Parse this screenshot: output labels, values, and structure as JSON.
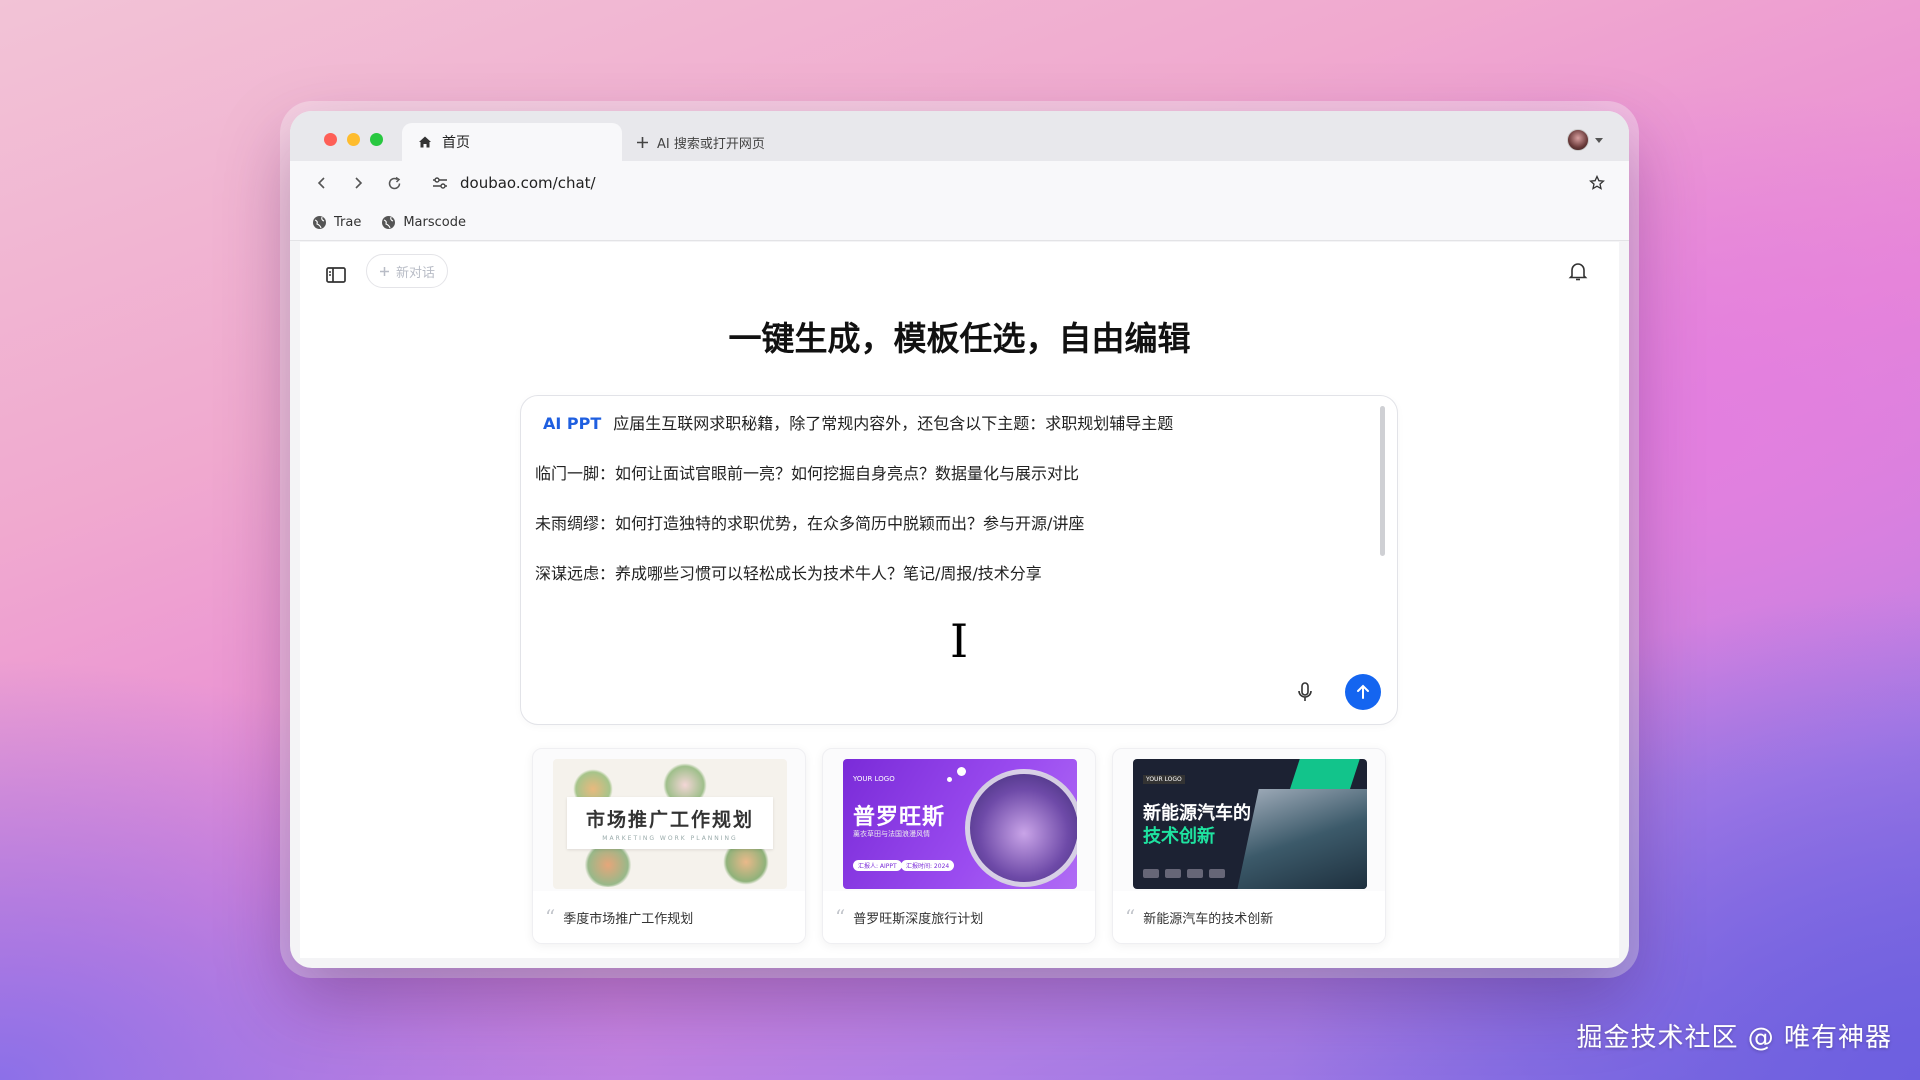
{
  "browser": {
    "active_tab": {
      "label": "首页",
      "icon": "home-icon"
    },
    "new_tab": {
      "label": "AI 搜索或打开网页",
      "icon": "plus-icon"
    },
    "url": "doubao.com/chat/",
    "bookmarks": [
      {
        "label": "Trae",
        "icon": "globe-icon"
      },
      {
        "label": "Marscode",
        "icon": "globe-icon"
      }
    ]
  },
  "page": {
    "new_chat_label": "新对话",
    "headline": "一键生成，模板任选，自由编辑",
    "composer": {
      "tag": "AI PPT",
      "lines": [
        "应届生互联网求职秘籍，除了常规内容外，还包含以下主题：求职规划辅导主题",
        "临门一脚：如何让面试官眼前一亮？如何挖掘自身亮点？数据量化与展示对比",
        "未雨绸缪：如何打造独特的求职优势，在众多简历中脱颖而出？参与开源/讲座",
        "深谋远虑：养成哪些习惯可以轻松成长为技术牛人？笔记/周报/技术分享"
      ]
    },
    "templates": [
      {
        "caption": "季度市场推广工作规划",
        "thumb_title": "市场推广工作规划",
        "thumb_sub": "MARKETING WORK PLANNING"
      },
      {
        "caption": "普罗旺斯深度旅行计划",
        "thumb_logo": "YOUR LOGO",
        "thumb_title": "普罗旺斯",
        "thumb_sub": "薰衣草田与法国浪漫风情",
        "thumb_pill_1": "汇报人: AIPPT",
        "thumb_pill_2": "汇报时间: 2024"
      },
      {
        "caption": "新能源汽车的技术创新",
        "thumb_logo": "YOUR LOGO",
        "thumb_title_1": "新能源汽车的",
        "thumb_title_2": "技术创新"
      }
    ]
  },
  "watermark": "掘金技术社区 @ 唯有神器",
  "colors": {
    "accent": "#1465f0",
    "ai_tag": "#1f5fe0"
  }
}
